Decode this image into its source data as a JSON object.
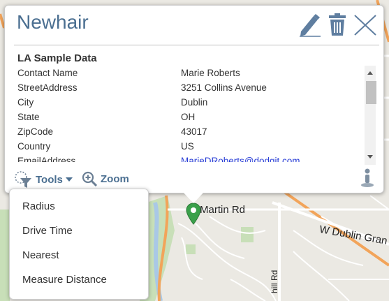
{
  "popup": {
    "title": "Newhair",
    "section_title": "LA Sample Data",
    "fields": [
      {
        "key": "Contact Name",
        "value": "Marie Roberts"
      },
      {
        "key": "StreetAddress",
        "value": "3251 Collins Avenue"
      },
      {
        "key": "City",
        "value": "Dublin"
      },
      {
        "key": "State",
        "value": "OH"
      },
      {
        "key": "ZipCode",
        "value": "43017"
      },
      {
        "key": "Country",
        "value": "US"
      },
      {
        "key": "EmailAddress",
        "value": "MarieDRoberts@dodgit.com"
      }
    ],
    "icons": {
      "edit": "pencil-icon",
      "delete": "trash-icon",
      "close": "close-icon"
    }
  },
  "toolbar": {
    "tools_label": "Tools",
    "zoom_label": "Zoom"
  },
  "tools_menu": {
    "items": [
      "Radius",
      "Drive Time",
      "Nearest",
      "Measure Distance"
    ]
  },
  "map": {
    "labels": {
      "martin_rd": "Martin Rd",
      "w_dublin": "W Dublin Gran",
      "hill_rd": "hill Rd"
    },
    "colors": {
      "accent": "#4b6f91",
      "marker": "#3aa04a",
      "road_major": "#f2a45a"
    }
  }
}
